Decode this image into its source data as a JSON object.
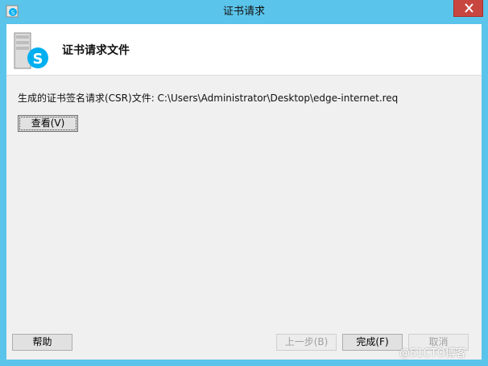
{
  "window": {
    "title": "证书请求",
    "header_title": "证书请求文件"
  },
  "content": {
    "csr_path_text": "生成的证书签名请求(CSR)文件: C:\\Users\\Administrator\\Desktop\\edge-internet.req",
    "view_button": "查看(V)"
  },
  "footer": {
    "help_button": "帮助",
    "back_button": "上一步(B)",
    "finish_button": "完成(F)",
    "cancel_button": "取消"
  },
  "watermark": "@51CTO博客",
  "colors": {
    "title_bar": "#5bc4ea",
    "close_button": "#c7463f",
    "skype_blue": "#00aff0"
  },
  "icons": {
    "app": "skype-app-icon",
    "header": "server-skype-icon",
    "close": "close-icon"
  }
}
